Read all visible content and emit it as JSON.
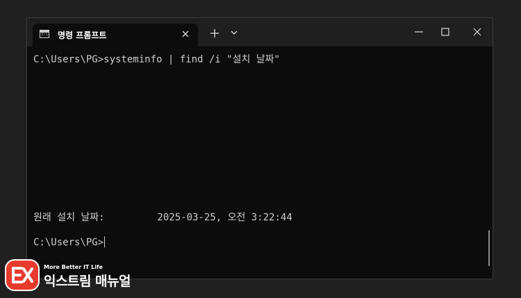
{
  "window": {
    "tab_title": "명령 프롬프트",
    "tab_icon": "C:\\"
  },
  "terminal": {
    "lines": [
      "C:\\Users\\PG>systeminfo | find /i \"설치 날짜\"",
      "원래 설치 날짜:         2025-03-25, 오전 3:22:44",
      "C:\\Users\\PG>"
    ]
  },
  "logo": {
    "tagline": "More Better IT Life",
    "name": "익스트림 매뉴얼"
  },
  "colors": {
    "page_background": "#202020",
    "terminal_background": "#0c0c0c",
    "titlebar_background": "#1f1f1f",
    "terminal_text": "#cccccc",
    "logo_red": "#e73b2e"
  },
  "icons": {
    "tab": "command-prompt-icon",
    "tab_close": "close-icon",
    "new_tab": "plus-icon",
    "dropdown": "chevron-down-icon",
    "minimize": "minimize-icon",
    "maximize": "maximize-icon",
    "close": "close-icon"
  }
}
